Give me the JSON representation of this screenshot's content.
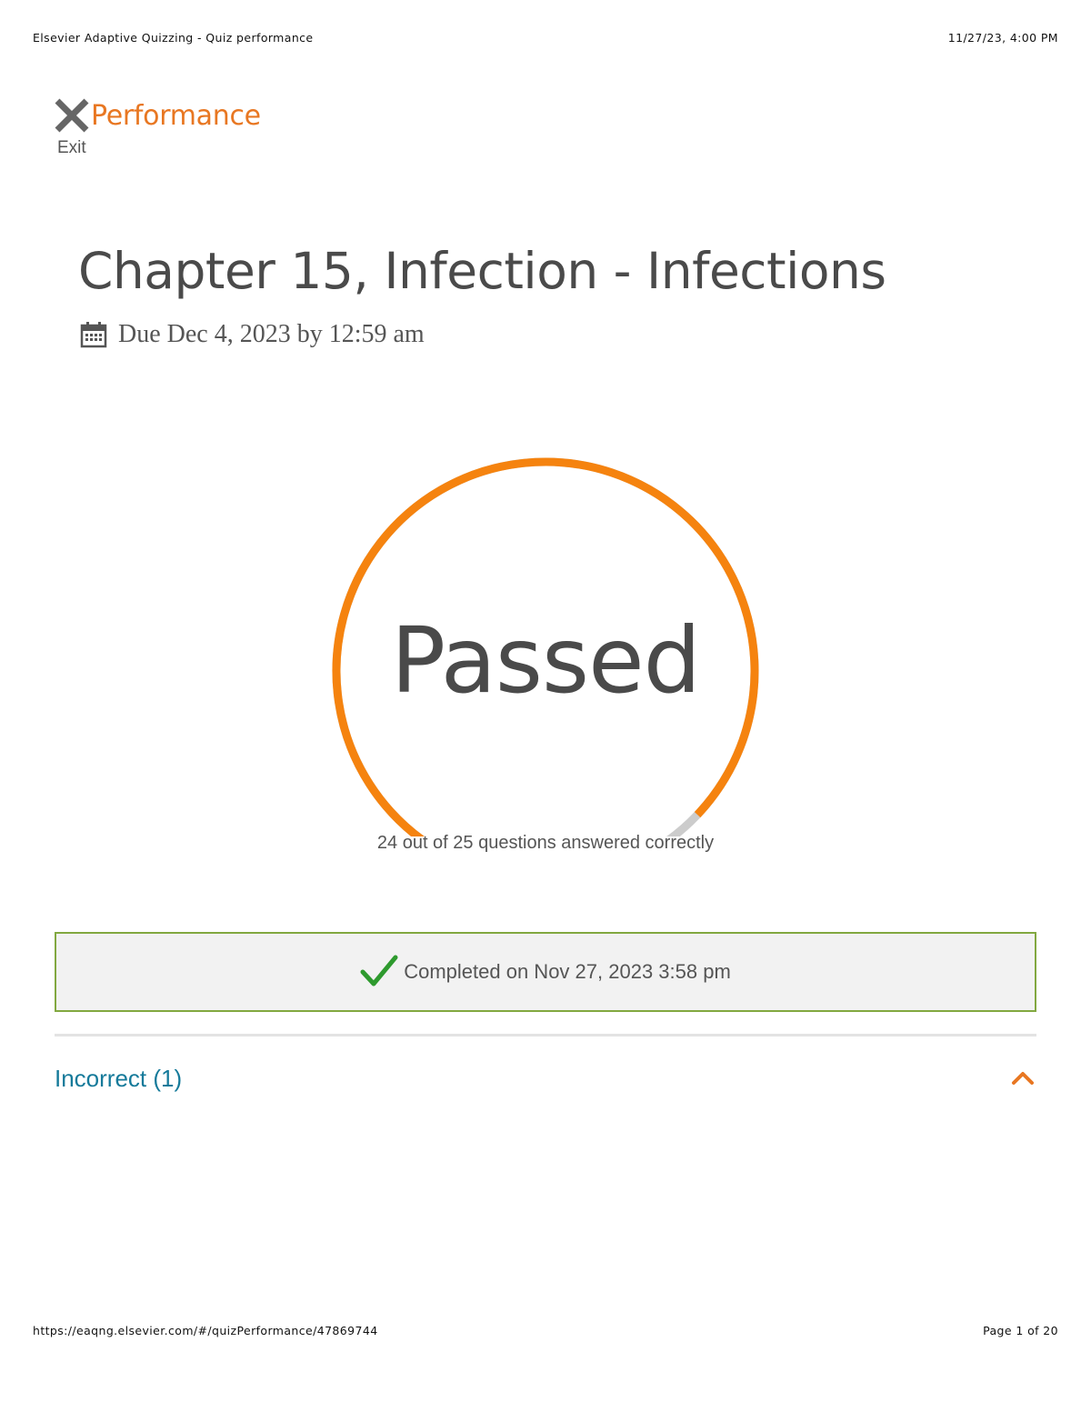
{
  "print_header": {
    "left": "Elsevier Adaptive Quizzing - Quiz performance",
    "right": "11/27/23, 4:00 PM"
  },
  "print_footer": {
    "left": "https://eaqng.elsevier.com/#/quizPerformance/47869744",
    "right": "Page 1 of 20"
  },
  "header": {
    "exit_label": "Exit",
    "exit_icon": "close-x-icon",
    "title": "Performance"
  },
  "quiz": {
    "title": "Chapter 15, Infection - Infections",
    "due_text": "Due Dec 4, 2023 by 12:59 am",
    "due_icon": "calendar-icon"
  },
  "gauge": {
    "status": "Passed",
    "correct": 24,
    "total": 25,
    "caption": "24 out of 25 questions answered correctly",
    "fill_color": "#f5830f",
    "track_color": "#cccccc"
  },
  "completion": {
    "text": "Completed on Nov 27, 2023 3:58 pm",
    "icon": "checkmark-icon",
    "check_color": "#2e9a2e"
  },
  "sections": {
    "incorrect_label": "Incorrect (1)",
    "toggle_icon": "chevron-up-icon"
  },
  "colors": {
    "accent": "#e87722",
    "link": "#157a9a",
    "success_border": "#82a840"
  }
}
